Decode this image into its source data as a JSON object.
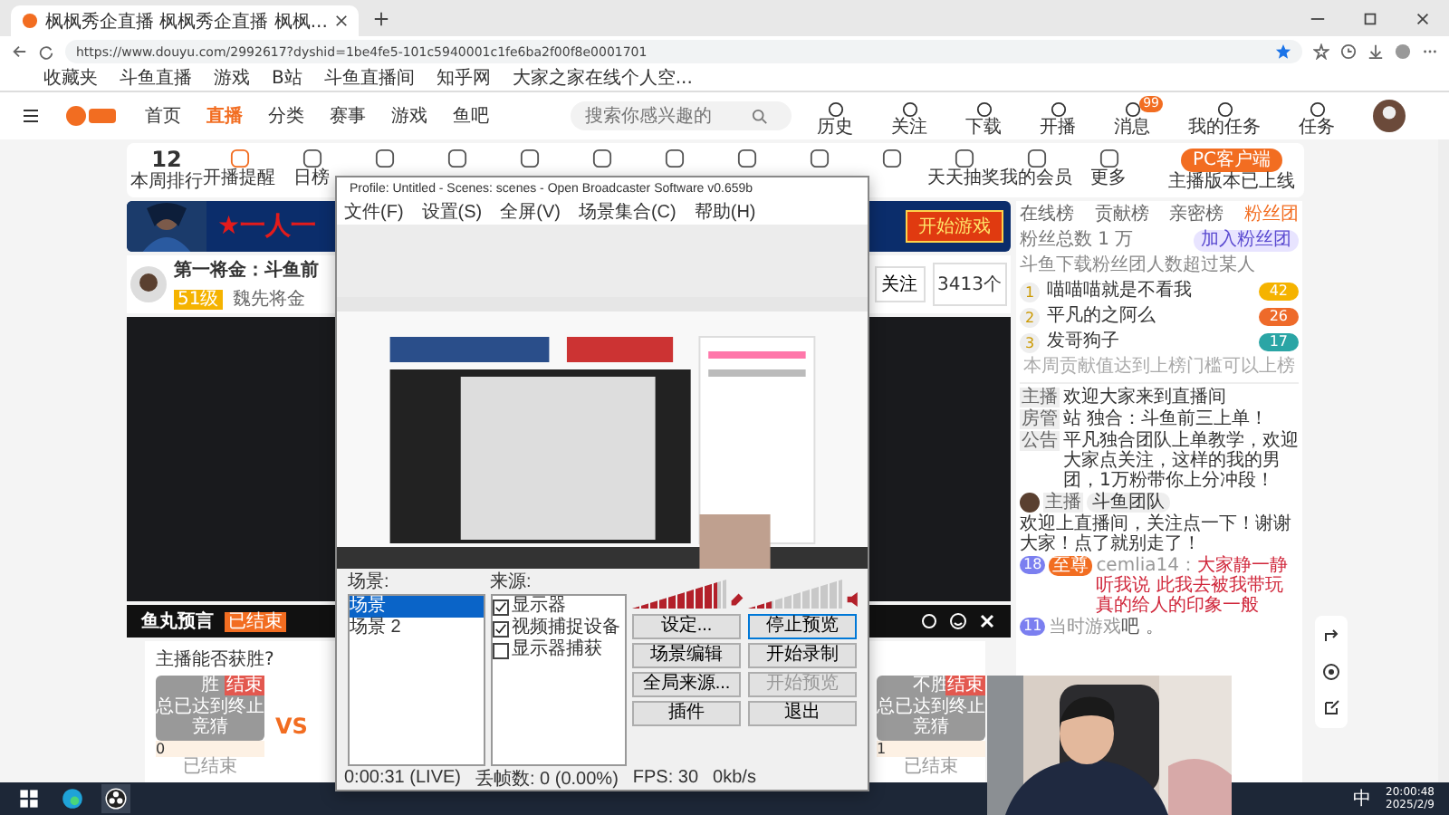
{
  "browser": {
    "tab_title": "枫枫秀企直播 枫枫秀企直播 枫枫...",
    "url": "https://www.douyu.com/2992617?dyshid=1be4fe5-101c5940001c1fe6ba2f00f8e0001701",
    "bookmarks": [
      "收藏夹",
      "斗鱼直播",
      "游戏",
      "B站",
      "斗鱼直播间",
      "知乎网",
      "大家之家在线个人空..."
    ]
  },
  "site": {
    "nav": [
      {
        "label": "首页",
        "selected": false
      },
      {
        "label": "直播",
        "selected": true
      },
      {
        "label": "分类",
        "selected": false
      },
      {
        "label": "赛事",
        "selected": false
      },
      {
        "label": "游戏",
        "selected": false
      },
      {
        "label": "鱼吧",
        "selected": false
      }
    ],
    "search": {
      "placeholder": "搜索你感兴趣的"
    },
    "header_actions": [
      "历史",
      "关注",
      "下载",
      "开播",
      "消息",
      "我的任务",
      "任务"
    ],
    "message_badge": "99"
  },
  "toolbar": {
    "rank_number": "12",
    "rank_label": "本周排行",
    "items": [
      {
        "kind": "labeled",
        "label": "开播提醒"
      },
      {
        "kind": "labeled",
        "label": "日榜"
      },
      {
        "kind": "icon"
      },
      {
        "kind": "icon"
      },
      {
        "kind": "icon"
      },
      {
        "kind": "icon"
      },
      {
        "kind": "icon"
      },
      {
        "kind": "icon"
      },
      {
        "kind": "icon"
      },
      {
        "kind": "icon"
      },
      {
        "kind": "labeled",
        "label": "天天抽奖"
      },
      {
        "kind": "labeled",
        "label": "我的会员"
      },
      {
        "kind": "labeled",
        "label": "更多"
      }
    ],
    "client_button": "PC客户端",
    "client_note": "主播版本已上线"
  },
  "banner": {
    "text": "★一人一",
    "button": "开始游戏"
  },
  "stream": {
    "title": "第一将金：斗鱼前",
    "level_badge": "51级",
    "streamer": "魏先将金",
    "follow_button": "关注",
    "share_count": "3413个"
  },
  "prediction": {
    "logo": "鱼丸预言",
    "logo_badge": "已结束",
    "question": "主播能否获胜?",
    "vs": "VS",
    "options": [
      {
        "label": "胜",
        "sub": "总已达到终止竞猜",
        "tag": "结束",
        "value": "0",
        "footer": "已结束"
      },
      {
        "label": "不胜",
        "sub": "总已达到终止竞猜",
        "tag": "结束",
        "value": "1",
        "footer": "已结束"
      }
    ]
  },
  "obs": {
    "title": "Profile: Untitled - Scenes: scenes - Open Broadcaster Software v0.659b",
    "menu": [
      "文件(F)",
      "设置(S)",
      "全屏(V)",
      "场景集合(C)",
      "帮助(H)"
    ],
    "scenes_label": "场景:",
    "scenes": [
      {
        "label": "场景",
        "selected": true
      },
      {
        "label": "场景 2",
        "selected": false
      }
    ],
    "sources_label": "来源:",
    "sources": [
      {
        "label": "显示器",
        "checked": true
      },
      {
        "label": "视频捕捉设备",
        "checked": true
      },
      {
        "label": "显示器捕获",
        "checked": false
      }
    ],
    "mic_meter": {
      "level": 0.9
    },
    "speaker_meter": {
      "level": 0.25
    },
    "buttons": [
      {
        "label": "设定...",
        "disabled": false,
        "active": false
      },
      {
        "label": "停止预览",
        "disabled": false,
        "active": true
      },
      {
        "label": "场景编辑",
        "disabled": false,
        "active": false
      },
      {
        "label": "开始录制",
        "disabled": false,
        "active": false
      },
      {
        "label": "全局来源...",
        "disabled": false,
        "active": false
      },
      {
        "label": "开始预览",
        "disabled": true,
        "active": false
      },
      {
        "label": "插件",
        "disabled": false,
        "active": false
      },
      {
        "label": "退出",
        "disabled": false,
        "active": false
      }
    ],
    "status": [
      "0:00:31 (LIVE)",
      "丢帧数: 0 (0.00%)",
      "FPS: 30",
      "0kb/s"
    ]
  },
  "ranking": {
    "tabs": [
      {
        "label": "在线榜",
        "selected": false
      },
      {
        "label": "贡献榜",
        "selected": false
      },
      {
        "label": "亲密榜",
        "selected": false
      },
      {
        "label": "粉丝团",
        "selected": true
      }
    ],
    "summary": "粉丝总数 1 万",
    "note": "斗鱼下载粉丝团人数超过某人",
    "join_button": "加入粉丝团",
    "entries": [
      {
        "rank": "1",
        "name": "喵喵喵就是不看我",
        "badge": "42",
        "color": "#f5b300"
      },
      {
        "rank": "2",
        "name": "平凡的之阿么",
        "badge": "26",
        "color": "#ee6a2a"
      },
      {
        "rank": "3",
        "name": "发哥狗子",
        "badge": "17",
        "color": "#2aa5a5"
      }
    ],
    "footer": "本周贡献值达到上榜门槛可以上榜"
  },
  "chat": [
    {
      "tag": "主播",
      "text": "欢迎大家来到直播间"
    },
    {
      "tag": "房管",
      "text": "站 独合：斗鱼前三上单！"
    },
    {
      "tag": "公告",
      "text": "平凡独合团队上单教学，欢迎大家点关注，这样的我的男团，1万粉带你上分冲段！"
    }
  ],
  "welcome": {
    "tag": "主播",
    "name": "斗鱼团队",
    "text": "欢迎上直播间，关注点一下！谢谢大家！点了就别走了！"
  },
  "messages": [
    {
      "level": "18",
      "badge": "至尊",
      "name": "cemlia14：",
      "text": "大家静一静听我说 此我去被我带玩真的给人的印象一般",
      "color": "#d0263a"
    },
    {
      "level": "11",
      "name": "当时游戏",
      "text": "吧 。",
      "color": "#555555"
    }
  ],
  "taskbar": {
    "time": "20:00:48",
    "date": "2025/2/9",
    "ime": "中"
  }
}
